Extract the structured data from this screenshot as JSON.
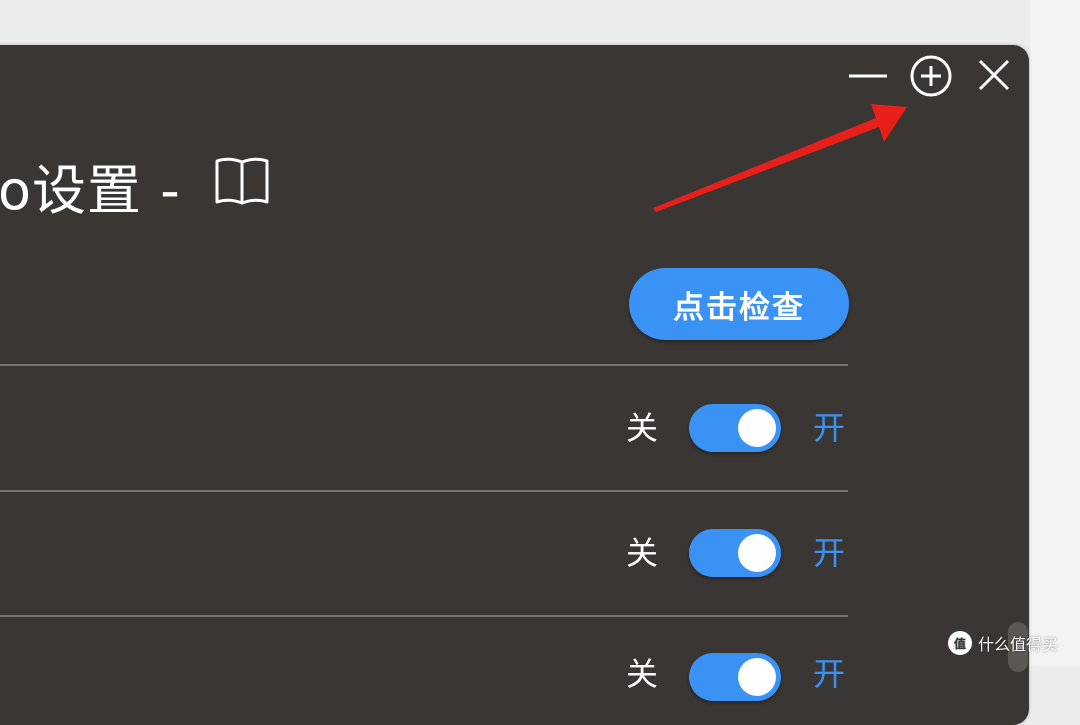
{
  "window": {
    "title": "o设置 -",
    "controls": {
      "minimize_icon": "minus-icon",
      "maximize_icon": "circle-plus-icon",
      "close_icon": "x-icon"
    },
    "book_icon": "open-book-icon"
  },
  "update_check": {
    "button_label": "点击检查"
  },
  "settings_rows": [
    {
      "off_label": "关",
      "on_label": "开",
      "enabled": true
    },
    {
      "off_label": "关",
      "on_label": "开",
      "enabled": true
    },
    {
      "off_label": "关",
      "on_label": "开",
      "enabled": true
    }
  ],
  "annotation": {
    "arrow_color": "#e8201c"
  },
  "watermark": {
    "text": "什么值得买",
    "logo_text": "值"
  },
  "colors": {
    "window_bg": "#3a3633",
    "accent": "#3b92f5",
    "divider": "#77736f",
    "text": "#ffffff"
  }
}
